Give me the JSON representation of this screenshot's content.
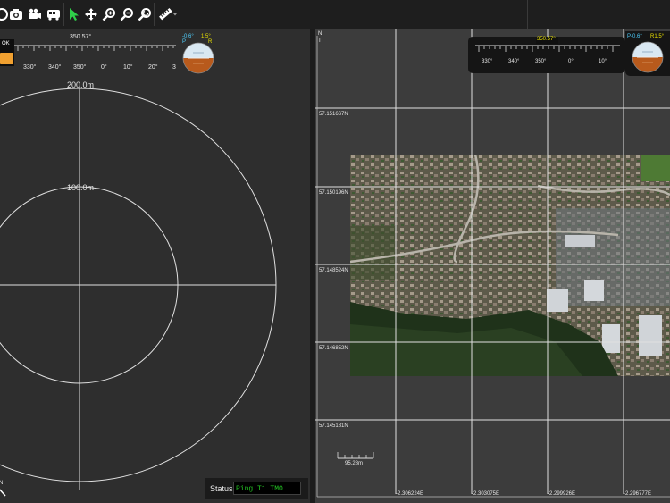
{
  "toolbar": {
    "tools": [
      {
        "name": "clock-icon",
        "glyph": "◷"
      },
      {
        "name": "camera-icon"
      },
      {
        "name": "video-camera-icon"
      },
      {
        "name": "bus-icon"
      },
      {
        "name": "select-cursor-icon"
      },
      {
        "name": "pan-move-icon"
      },
      {
        "name": "zoom-in-icon"
      },
      {
        "name": "zoom-out-icon"
      },
      {
        "name": "zoom-fit-icon"
      },
      {
        "name": "measure-ruler-icon"
      }
    ]
  },
  "left_view": {
    "ok_label": "OK",
    "heading_value": "350.57°",
    "tape_labels": [
      "330°",
      "340°",
      "350°",
      "0°",
      "10°",
      "20°",
      "3"
    ],
    "pitch_label": "-0.6°",
    "roll_label": "1.5°",
    "p_label": "P",
    "r_label": "R",
    "range_outer": "200.0m",
    "range_inner": "100.0m",
    "north_mark": "N",
    "status": {
      "label": "Status",
      "value": "Ping T1 TMO"
    }
  },
  "right_view": {
    "north_mark": "N",
    "t_mark": "T",
    "heading_value": "350.57°",
    "tape_labels": [
      "330°",
      "340°",
      "350°",
      "0°",
      "10°"
    ],
    "pitch_label": "P-0.6°",
    "roll_label": "R1.5°",
    "lat_labels": [
      "57.151667N",
      "57.150196N",
      "57.148524N",
      "57.146852N",
      "57.145181N"
    ],
    "lon_labels": [
      "-2.306224E",
      "-2.303075E",
      "-2.299926E",
      "-2.296777E"
    ],
    "scale_label": "95.28m"
  },
  "colors": {
    "accent_orange": "#f0a030",
    "status_green": "#23c423",
    "heading_highlight": "#e8e000",
    "pitch_cyan": "#4fd0ff",
    "cursor_green": "#2fd04a"
  }
}
